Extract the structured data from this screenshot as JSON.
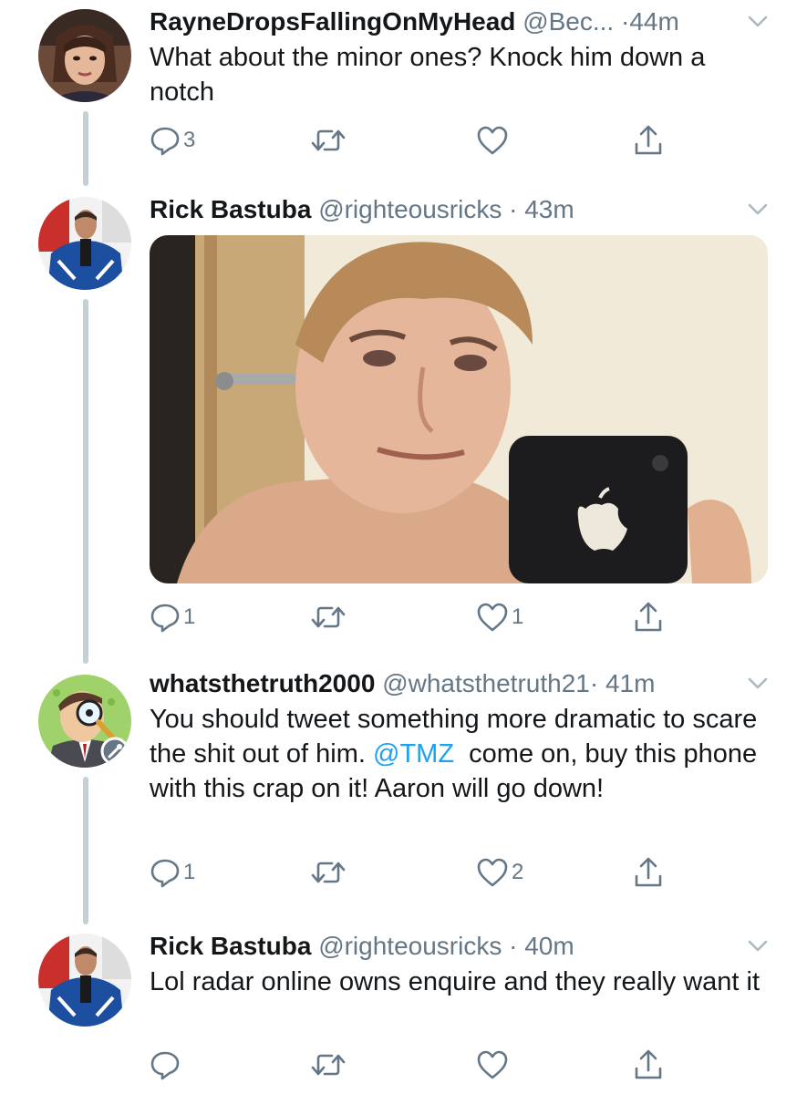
{
  "tweets": [
    {
      "name": "RayneDropsFallingOnMyHead",
      "handle": "@Bec...",
      "dot": "·",
      "time": "44m",
      "text": "What about the minor ones? Knock him down a notch",
      "actions": {
        "reply_count": "3",
        "retweet_count": "",
        "like_count": ""
      }
    },
    {
      "name": "Rick Bastuba",
      "handle": "@righteousricks",
      "dot": "·",
      "time": "43m",
      "text": "",
      "actions": {
        "reply_count": "1",
        "retweet_count": "",
        "like_count": "1"
      }
    },
    {
      "name": "whatsthetruth2000",
      "handle": "@whatsthetruth21",
      "dot": "·",
      "time": "41m",
      "text_before": "You should tweet something more dramatic to scare the shit out of him. ",
      "mention": "@TMZ",
      "text_after": "  come on, buy this phone with this crap on it! Aaron will go down!",
      "actions": {
        "reply_count": "1",
        "retweet_count": "",
        "like_count": "2"
      }
    },
    {
      "name": "Rick Bastuba",
      "handle": "@righteousricks",
      "dot": "·",
      "time": "40m",
      "text": "Lol radar online owns enquire and they really want it",
      "actions": {
        "reply_count": "",
        "retweet_count": "",
        "like_count": ""
      }
    }
  ],
  "icons": {
    "reply": "reply-icon",
    "retweet": "retweet-icon",
    "like": "heart-icon",
    "share": "share-icon",
    "menu": "chevron-down-icon"
  },
  "colors": {
    "text": "#14171a",
    "secondary": "#657786",
    "mention": "#1da1f2",
    "thread_line": "#c4cfd6"
  }
}
